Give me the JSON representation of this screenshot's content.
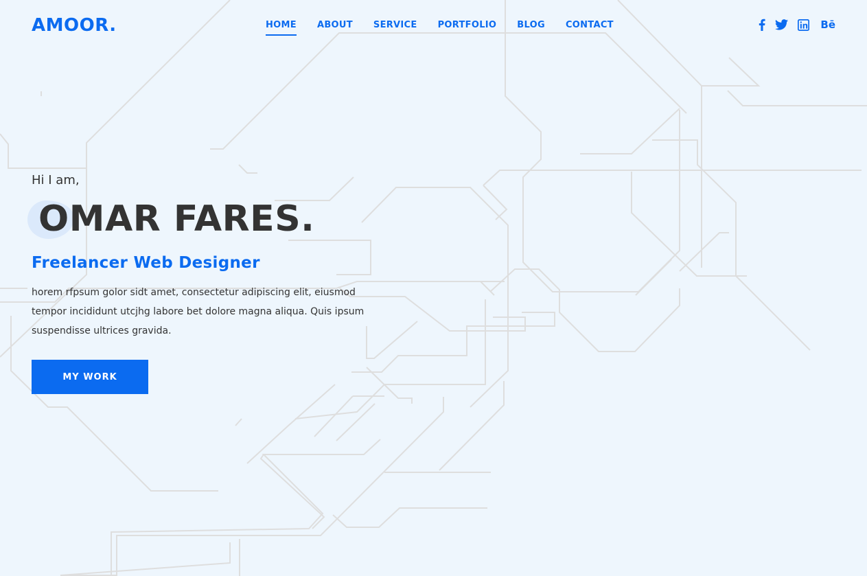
{
  "brand": {
    "logo": "AMOOR."
  },
  "nav": {
    "items": [
      {
        "label": "HOME",
        "active": true
      },
      {
        "label": "ABOUT",
        "active": false
      },
      {
        "label": "SERVICE",
        "active": false
      },
      {
        "label": "PORTFOLIO",
        "active": false
      },
      {
        "label": "BLOG",
        "active": false
      },
      {
        "label": "CONTACT",
        "active": false
      }
    ]
  },
  "social": {
    "icons": [
      "facebook-icon",
      "twitter-icon",
      "linkedin-icon",
      "behance-icon"
    ],
    "behance_label": "Bē"
  },
  "hero": {
    "greeting": "Hi I am,",
    "name": "OMAR FARES.",
    "role": "Freelancer Web Designer",
    "description": "horem rfpsum golor sidt amet, consectetur adipiscing elit, eiusmod tempor incididunt utcjhg labore bet dolore magna aliqua. Quis ipsum suspendisse ultrices gravida.",
    "cta_label": "MY WORK"
  },
  "colors": {
    "accent": "#0b6bf0",
    "background": "#eef6fd",
    "text": "#333333",
    "lines": "#dedede"
  }
}
